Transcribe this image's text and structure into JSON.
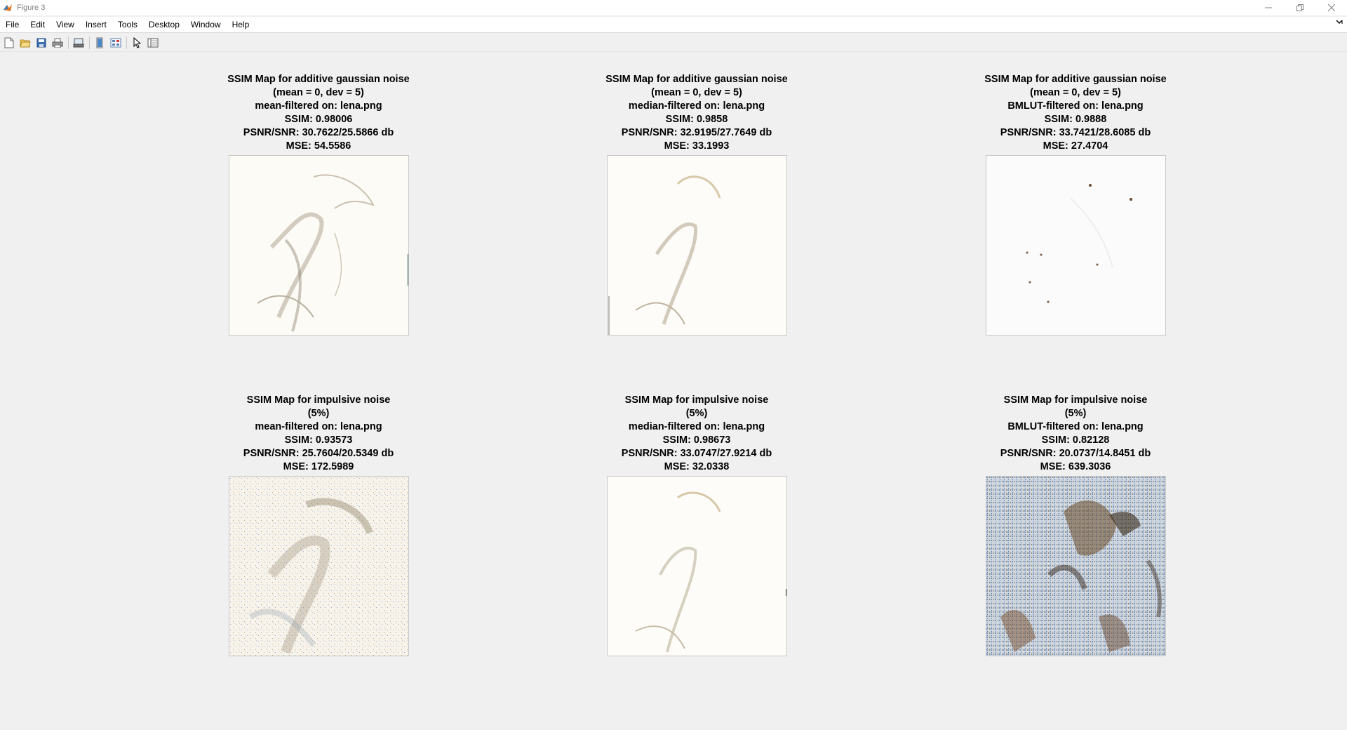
{
  "window": {
    "title": "Figure 3",
    "controls": [
      "minimize-icon",
      "restore-icon",
      "close-icon"
    ]
  },
  "menu": {
    "items": [
      "File",
      "Edit",
      "View",
      "Insert",
      "Tools",
      "Desktop",
      "Window",
      "Help"
    ]
  },
  "toolbar": {
    "buttons": [
      "new-figure-icon",
      "open-file-icon",
      "save-icon",
      "print-icon",
      "print-preview-icon",
      "link-plot-icon",
      "insert-colorbar-icon",
      "edit-plot-icon",
      "property-inspector-icon"
    ]
  },
  "subplots": [
    {
      "title_lines": [
        "SSIM Map for additive gaussian noise",
        "(mean = 0, dev = 5)",
        "mean-filtered on: lena.png",
        "SSIM: 0.98006",
        "PSNR/SNR: 30.7622/25.5866 db",
        "MSE: 54.5586"
      ]
    },
    {
      "title_lines": [
        "SSIM Map for additive gaussian noise",
        "(mean = 0, dev = 5)",
        "median-filtered on: lena.png",
        "SSIM: 0.9858",
        "PSNR/SNR: 32.9195/27.7649 db",
        "MSE: 33.1993"
      ]
    },
    {
      "title_lines": [
        "SSIM Map for additive gaussian noise",
        "(mean = 0, dev = 5)",
        "BMLUT-filtered on: lena.png",
        "SSIM: 0.9888",
        "PSNR/SNR: 33.7421/28.6085 db",
        "MSE: 27.4704"
      ]
    },
    {
      "title_lines": [
        "SSIM Map for impulsive noise",
        "(5%)",
        "mean-filtered on: lena.png",
        "SSIM: 0.93573",
        "PSNR/SNR: 25.7604/20.5349 db",
        "MSE: 172.5989"
      ]
    },
    {
      "title_lines": [
        "SSIM Map for impulsive noise",
        "(5%)",
        "median-filtered on: lena.png",
        "SSIM: 0.98673",
        "PSNR/SNR: 33.0747/27.9214 db",
        "MSE: 32.0338"
      ]
    },
    {
      "title_lines": [
        "SSIM Map for impulsive noise",
        "(5%)",
        "BMLUT-filtered on: lena.png",
        "SSIM: 0.82128",
        "PSNR/SNR: 20.0737/14.8451 db",
        "MSE: 639.3036"
      ]
    }
  ]
}
